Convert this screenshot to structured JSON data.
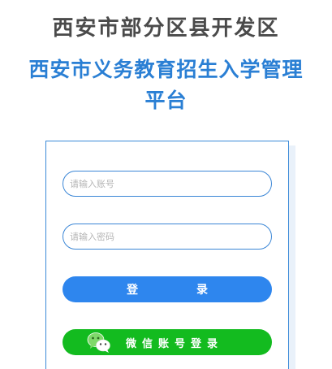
{
  "header": {
    "subtitle": "西安市部分区县开发区",
    "title_line1": "西安市义务教育招生入学管理",
    "title_line2": "平台"
  },
  "login_form": {
    "account_placeholder": "请输入账号",
    "password_placeholder": "请输入密码",
    "login_char1": "登",
    "login_char2": "录",
    "wechat_label": "微信账号登录",
    "wechat_icon": "wechat-icon"
  },
  "colors": {
    "title_blue": "#2a7fd4",
    "subtitle_gray": "#4a4a4a",
    "login_button": "#2e86ee",
    "wechat_button": "#13bb1f",
    "card_border": "#3a8ad8"
  }
}
